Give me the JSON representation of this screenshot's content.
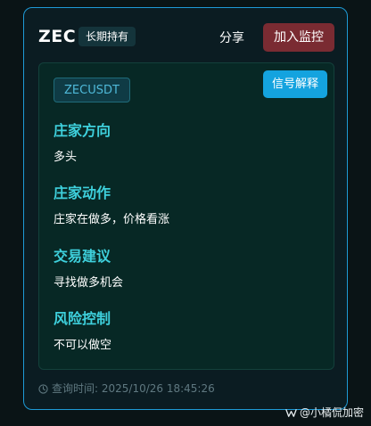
{
  "header": {
    "symbol": "ZEC",
    "hold_tag": "长期持有",
    "share_label": "分享",
    "monitor_label": "加入监控"
  },
  "panel": {
    "pair": "ZECUSDT",
    "explain_label": "信号解释",
    "sections": [
      {
        "title": "庄家方向",
        "value": "多头"
      },
      {
        "title": "庄家动作",
        "value": "庄家在做多，价格看涨"
      },
      {
        "title": "交易建议",
        "value": "寻找做多机会"
      },
      {
        "title": "风险控制",
        "value": "不可以做空"
      }
    ]
  },
  "footer": {
    "query_time": "查询时间: 2025/10/26 18:45:26"
  },
  "watermark": {
    "text": "@小橘侃加密"
  },
  "colors": {
    "accent_border": "#1e9ad6",
    "section_title": "#3ed0dc",
    "monitor_button": "#7a2b32",
    "explain_button": "#14a3df",
    "panel_bg": "#072825"
  }
}
